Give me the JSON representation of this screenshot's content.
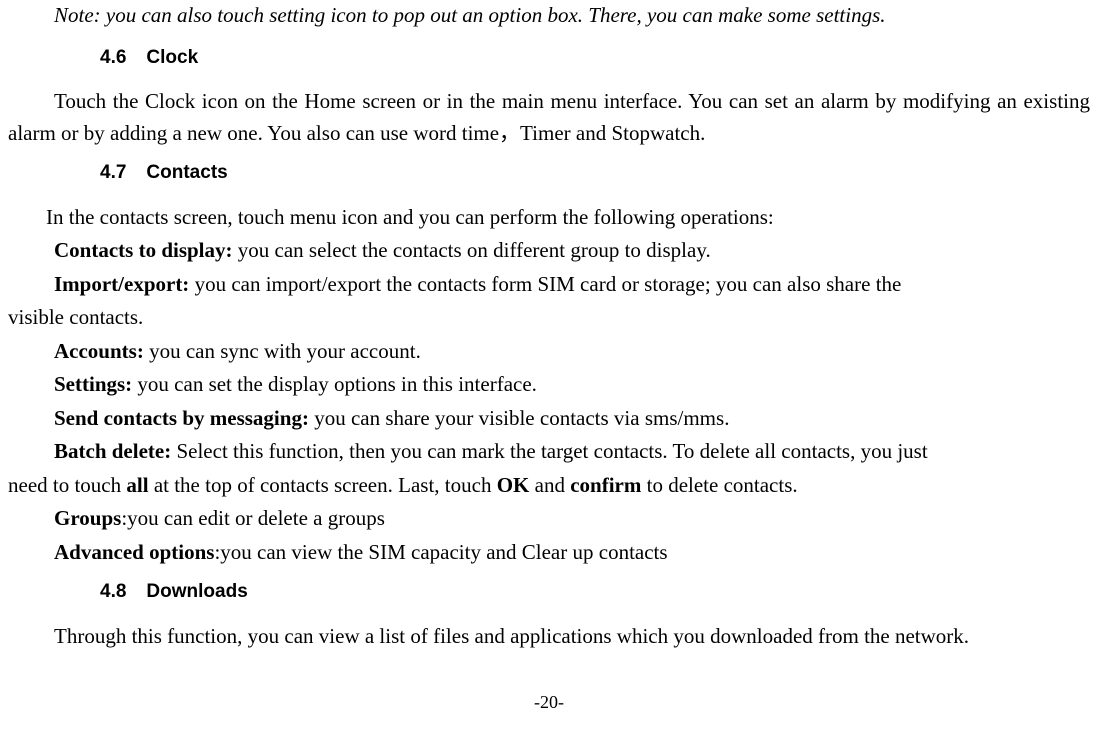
{
  "note": "Note: you can also touch setting icon to pop out an option box. There, you can make some settings.",
  "section46": {
    "num": "4.6",
    "title": "Clock",
    "body": "Touch the Clock icon on the Home screen or in the main menu interface. You can set an alarm by modifying an existing alarm or by adding a new one. You also can use word time，Timer and Stopwatch."
  },
  "section47": {
    "num": "4.7",
    "title": "Contacts",
    "intro": "In the contacts screen, touch menu icon and you can perform the following operations:",
    "items": {
      "contacts_to_display": {
        "label": "Contacts to display:",
        "text": " you can select the contacts on different group to display."
      },
      "import_export": {
        "label": "Import/export:",
        "text_part1": " you can import/export the contacts form SIM card or storage; you can also share the",
        "text_part2": "visible contacts."
      },
      "accounts": {
        "label": "Accounts:",
        "text": " you can sync with your account."
      },
      "settings": {
        "label": "Settings:",
        "text": " you can set the display options in this interface."
      },
      "send_contacts": {
        "label": "Send contacts by messaging:",
        "text": " you can share your visible contacts via sms/mms."
      },
      "batch_delete": {
        "label": "Batch delete:",
        "text_part1": " Select this function, then you can mark the target contacts. To delete all contacts, you just",
        "text_part2_a": "need to touch ",
        "all_bold": "all",
        "text_part2_b": " at the top of contacts screen. Last, touch ",
        "ok_bold": "OK",
        "text_part2_c": " and ",
        "confirm_bold": "confirm",
        "text_part2_d": " to delete contacts."
      },
      "groups": {
        "label": "Groups",
        "text": ":you can edit or delete a groups"
      },
      "advanced": {
        "label": "Advanced options",
        "text": ":you can view the SIM capacity and Clear up contacts"
      }
    }
  },
  "section48": {
    "num": "4.8",
    "title": "Downloads",
    "body": "Through this function, you can view a list of files and applications which you downloaded from the network."
  },
  "page_number": "-20-"
}
